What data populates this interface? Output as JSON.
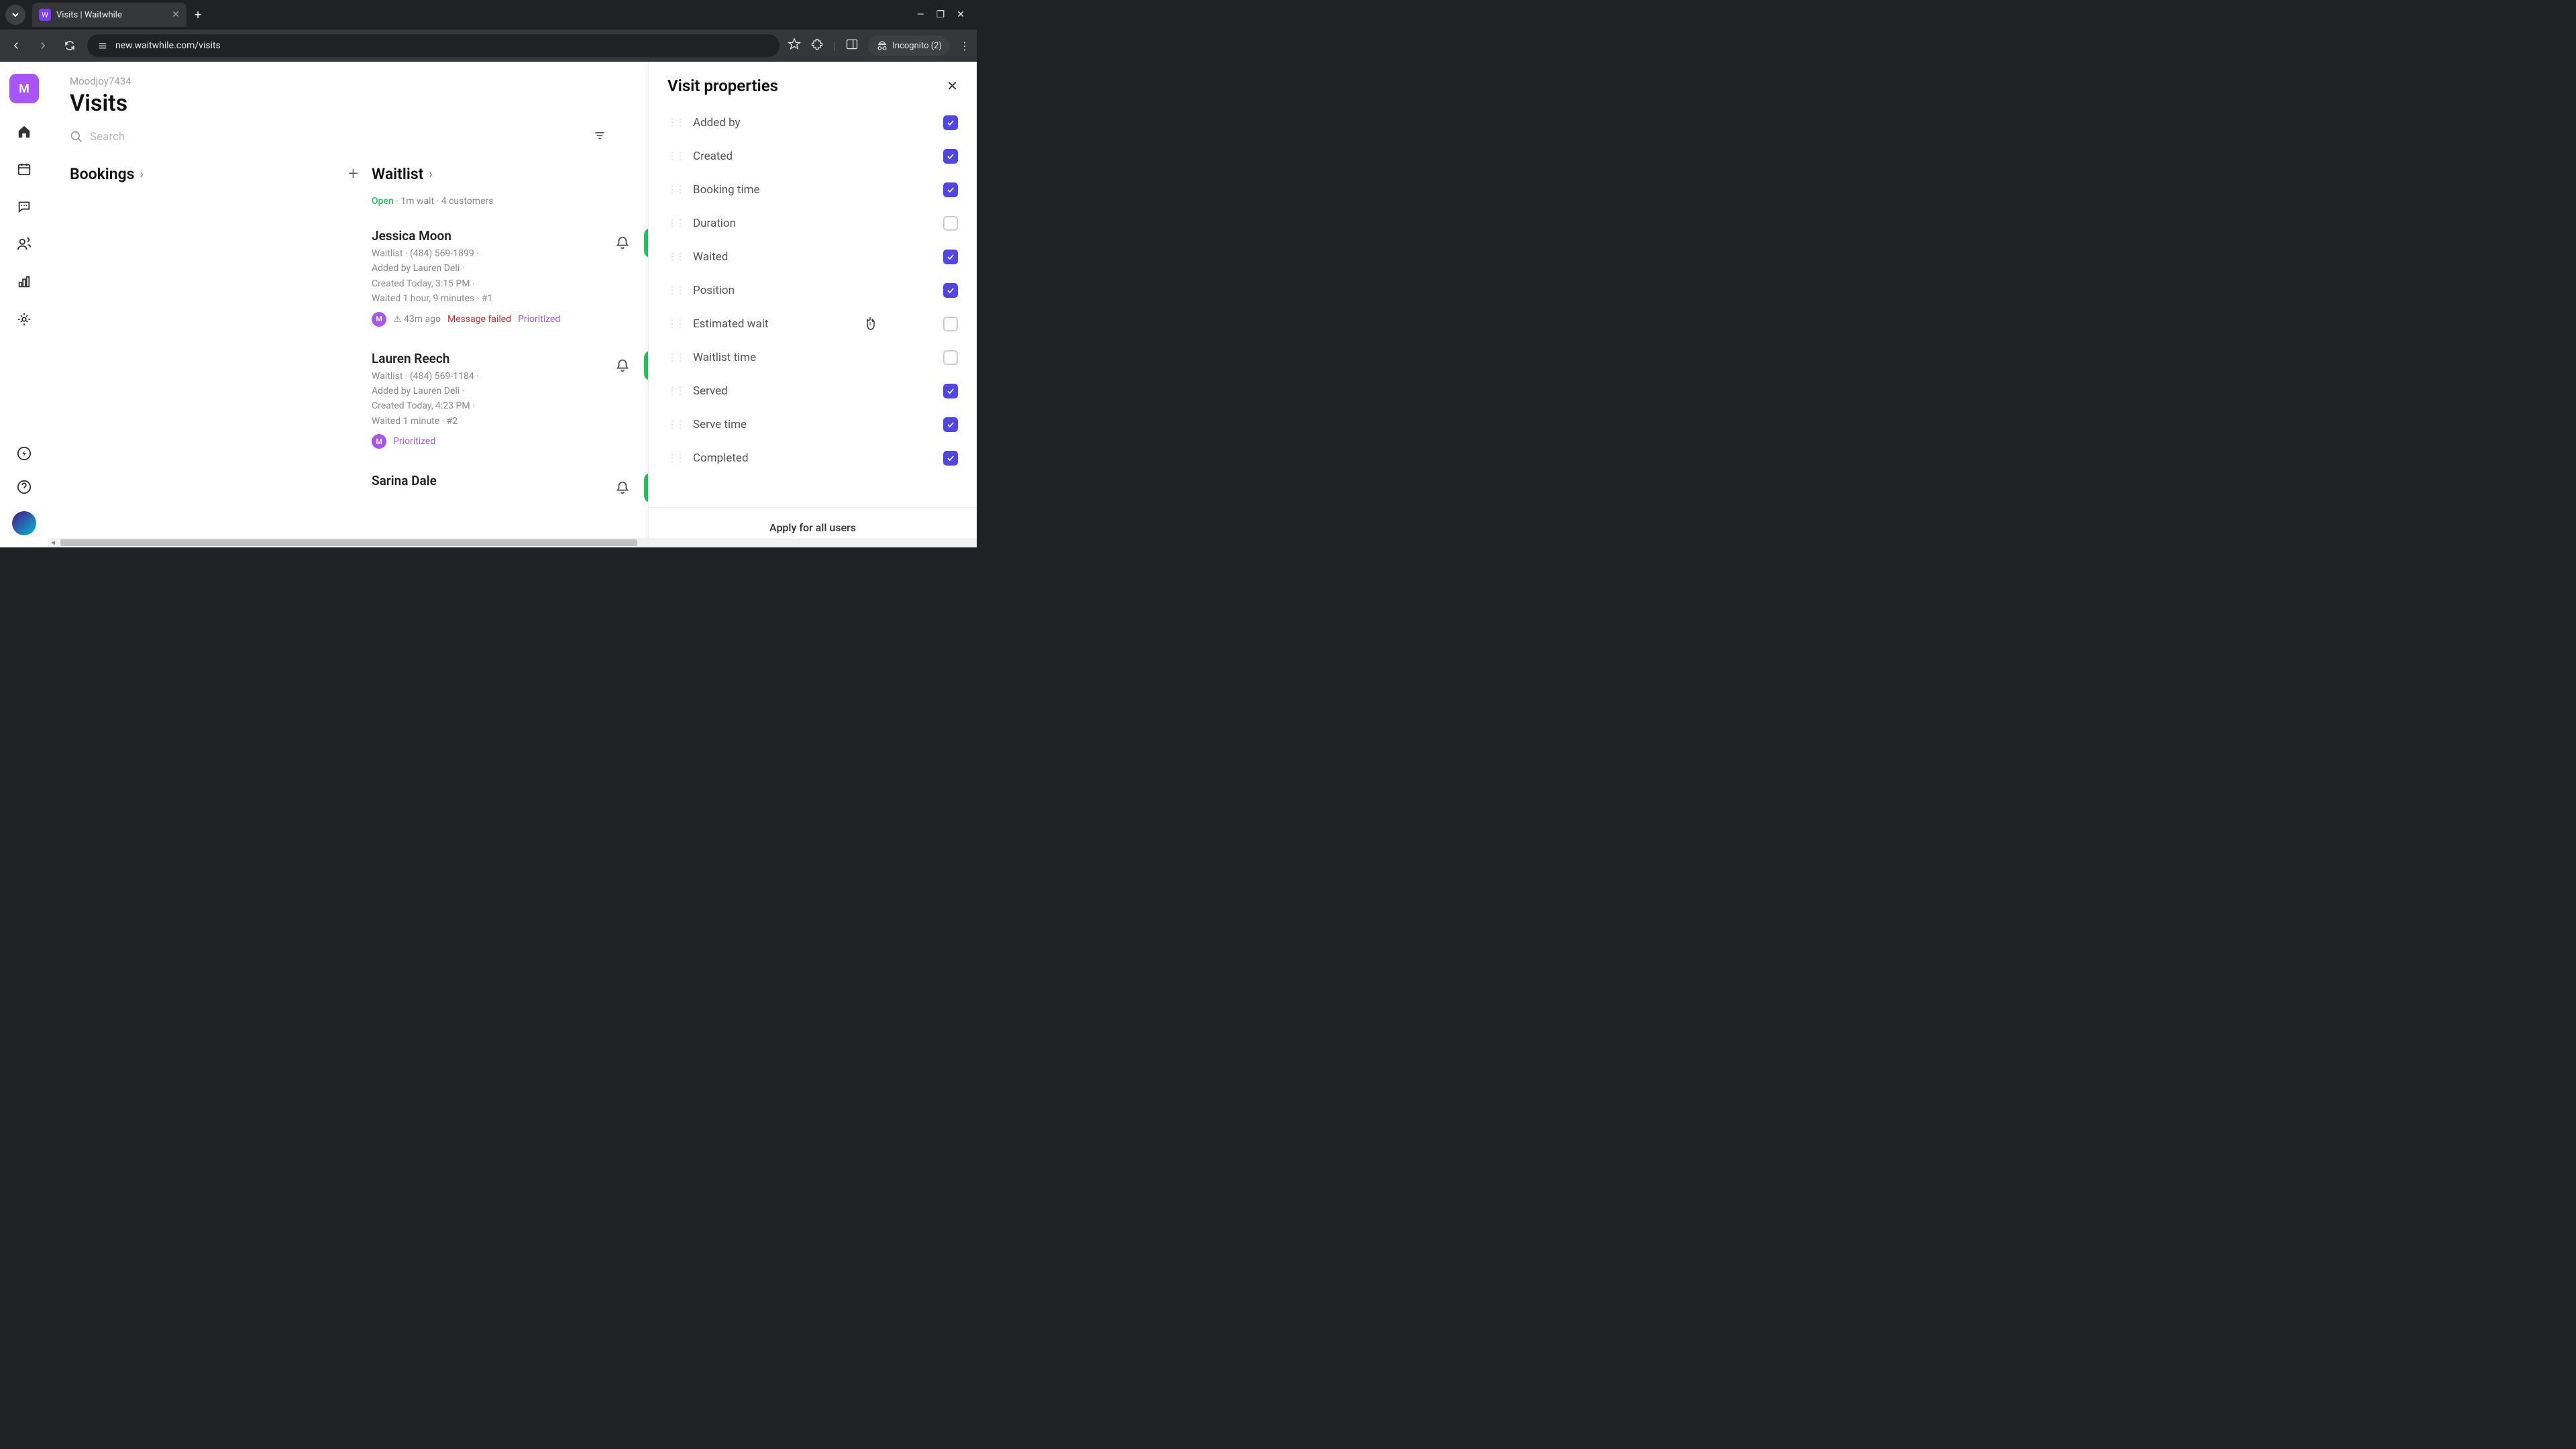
{
  "browser": {
    "tab_title": "Visits | Waitwhile",
    "url": "new.waitwhile.com/visits",
    "incognito_label": "Incognito (2)"
  },
  "app": {
    "org_name": "Moodjoy7434",
    "page_title": "Visits",
    "search_placeholder": "Search",
    "workspace_initial": "M"
  },
  "columns": {
    "bookings": {
      "title": "Bookings"
    },
    "waitlist": {
      "title": "Waitlist",
      "status_open": "Open",
      "status_rest": " · 1m wait · 4 customers"
    }
  },
  "customers": [
    {
      "name": "Jessica Moon",
      "line1": "Waitlist · (484) 569-1899 ·",
      "line2": "Added by Lauren Deli ·",
      "line3": "Created Today, 3:15 PM ·",
      "line4": "Waited 1 hour, 9 minutes · #1",
      "badge_initial": "M",
      "time_ago": "⚠ 43m ago",
      "failed": "Message failed",
      "priority": "Prioritized"
    },
    {
      "name": "Lauren Reech",
      "line1": "Waitlist · (484) 569-1184 ·",
      "line2": "Added by Lauren Deli ·",
      "line3": "Created Today, 4:23 PM ·",
      "line4": "Waited 1 minute · #2",
      "badge_initial": "M",
      "priority": "Prioritized"
    },
    {
      "name": "Sarina Dale"
    }
  ],
  "panel": {
    "title": "Visit properties",
    "apply_label": "Apply for all users",
    "properties": [
      {
        "label": "Added by",
        "checked": true
      },
      {
        "label": "Created",
        "checked": true
      },
      {
        "label": "Booking time",
        "checked": true
      },
      {
        "label": "Duration",
        "checked": false
      },
      {
        "label": "Waited",
        "checked": true
      },
      {
        "label": "Position",
        "checked": true
      },
      {
        "label": "Estimated wait",
        "checked": false
      },
      {
        "label": "Waitlist time",
        "checked": false
      },
      {
        "label": "Served",
        "checked": true
      },
      {
        "label": "Serve time",
        "checked": true
      },
      {
        "label": "Completed",
        "checked": true
      }
    ]
  }
}
